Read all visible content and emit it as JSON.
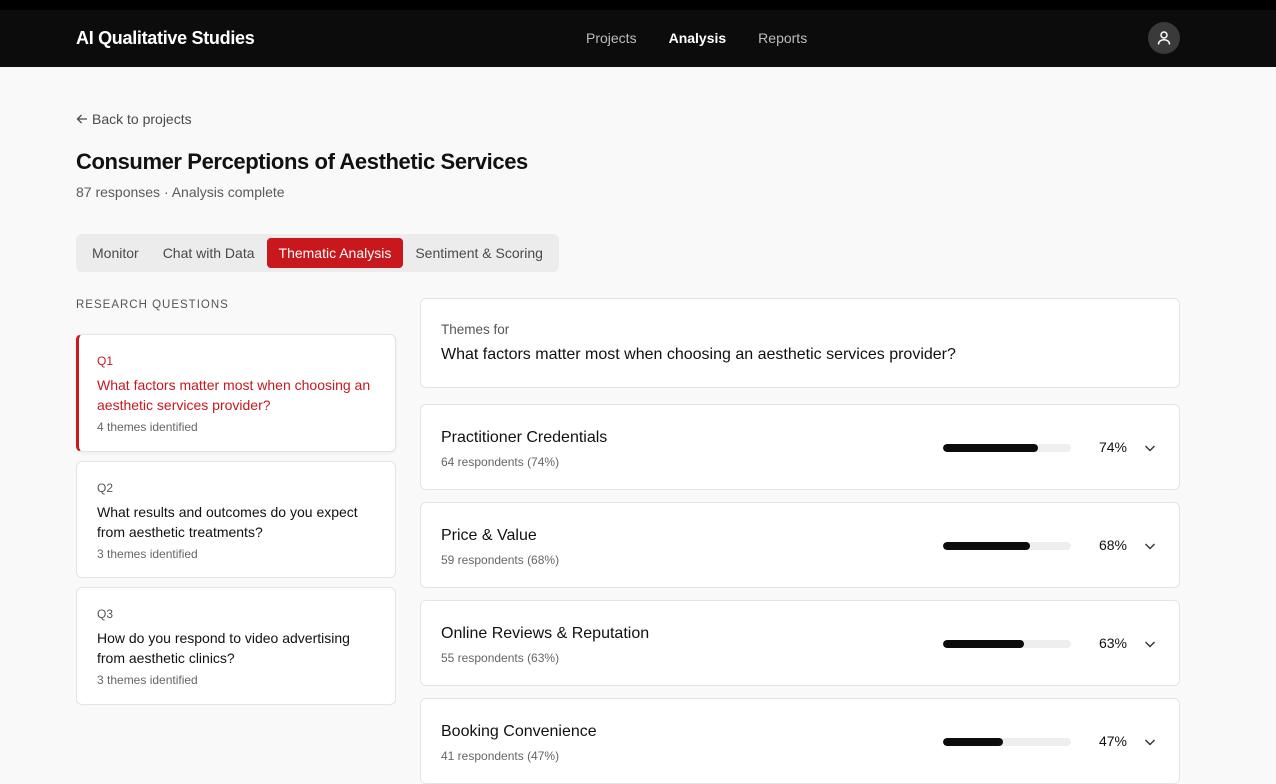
{
  "header": {
    "brand": "AI Qualitative Studies",
    "nav": [
      {
        "label": "Projects"
      },
      {
        "label": "Analysis"
      },
      {
        "label": "Reports"
      }
    ]
  },
  "page": {
    "back_label": "Back to projects",
    "title": "Consumer Perceptions of Aesthetic Services",
    "subtitle": "87 responses · Analysis complete"
  },
  "tabs": [
    {
      "label": "Monitor"
    },
    {
      "label": "Chat with Data"
    },
    {
      "label": "Thematic Analysis"
    },
    {
      "label": "Sentiment & Scoring"
    }
  ],
  "research": {
    "label": "RESEARCH QUESTIONS",
    "questions": [
      {
        "num": "Q1",
        "text": "What factors matter most when choosing an aesthetic services provider?",
        "themes": "4 themes identified"
      },
      {
        "num": "Q2",
        "text": "What results and outcomes do you expect from aesthetic treatments?",
        "themes": "3 themes identified"
      },
      {
        "num": "Q3",
        "text": "How do you respond to video advertising from aesthetic clinics?",
        "themes": "3 themes identified"
      }
    ]
  },
  "themes_panel": {
    "label": "Themes for",
    "question": "What factors matter most when choosing an aesthetic services provider?",
    "themes": [
      {
        "name": "Practitioner Credentials",
        "meta": "64 respondents (74%)",
        "percent": 74,
        "percent_label": "74%"
      },
      {
        "name": "Price & Value",
        "meta": "59 respondents (68%)",
        "percent": 68,
        "percent_label": "68%"
      },
      {
        "name": "Online Reviews & Reputation",
        "meta": "55 respondents (63%)",
        "percent": 63,
        "percent_label": "63%"
      },
      {
        "name": "Booking Convenience",
        "meta": "41 respondents (47%)",
        "percent": 47,
        "percent_label": "47%"
      }
    ]
  },
  "colors": {
    "accent": "#c8171d",
    "header_bg": "#0c0c0c",
    "bar_fill": "#0c0c0c",
    "bar_track": "#eeeeee"
  },
  "icons": {
    "avatar": "user-icon",
    "back": "arrow-left-icon",
    "expand": "chevron-down-icon"
  }
}
